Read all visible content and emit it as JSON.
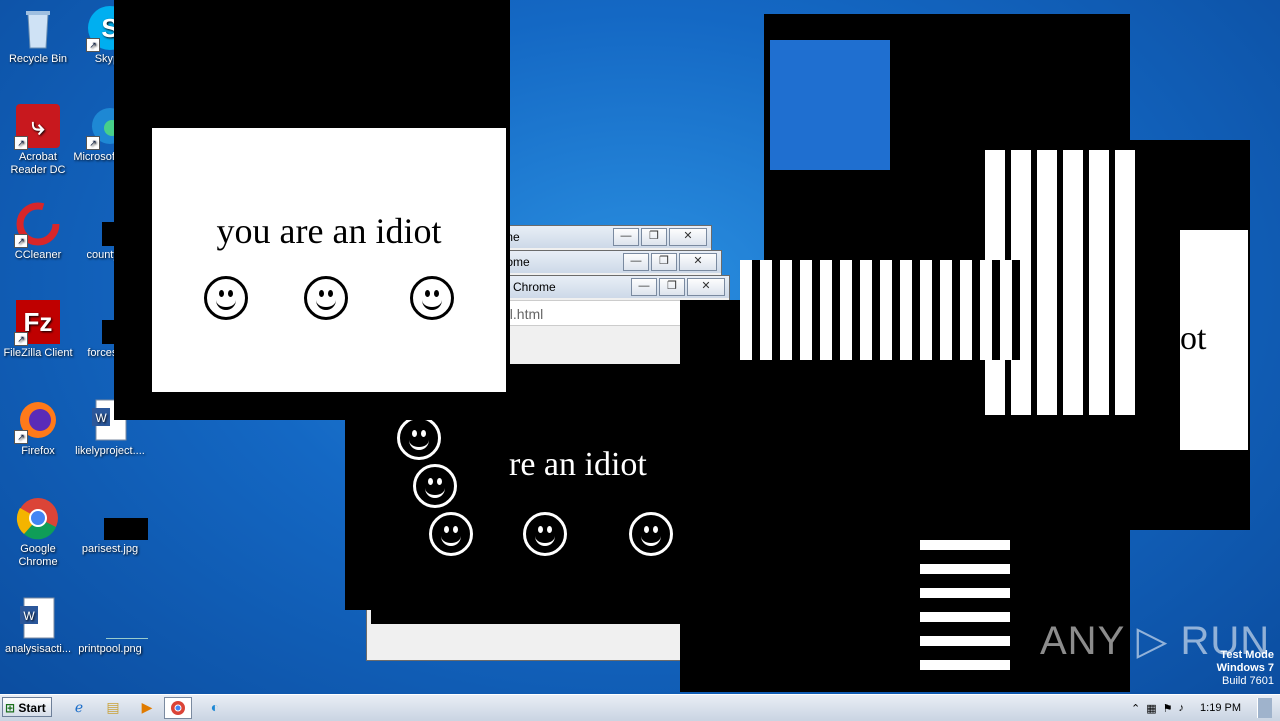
{
  "desktop": {
    "icons": [
      {
        "label": "Recycle Bin",
        "icon": "recycle-bin-icon"
      },
      {
        "label": "Skype",
        "icon": "skype-icon"
      },
      {
        "label": "Acrobat Reader DC",
        "icon": "acrobat-icon"
      },
      {
        "label": "Microsoft Edge",
        "icon": "edge-icon"
      },
      {
        "label": "CCleaner",
        "icon": "ccleaner-icon"
      },
      {
        "label": "countys...",
        "icon": "file-icon"
      },
      {
        "label": "FileZilla Client",
        "icon": "filezilla-icon"
      },
      {
        "label": "forcesh...",
        "icon": "file-icon"
      },
      {
        "label": "Firefox",
        "icon": "firefox-icon"
      },
      {
        "label": "likelyproject....",
        "icon": "word-doc-icon"
      },
      {
        "label": "Google Chrome",
        "icon": "chrome-icon"
      },
      {
        "label": "parisest.jpg",
        "icon": "image-icon"
      },
      {
        "label": "analysisacti...",
        "icon": "word-doc-icon"
      },
      {
        "label": "printpool.png",
        "icon": "image-icon"
      }
    ]
  },
  "popups": {
    "main_text": "you are an idiot",
    "partial_text": "re an idiot",
    "right_partial": "ot",
    "url_fragment": "ol.html",
    "chrome_titles": [
      "Chrome",
      "Chrome",
      "e Chrome"
    ]
  },
  "window_buttons": {
    "minimize": "—",
    "restore": "❐",
    "close": "✕"
  },
  "taskbar": {
    "start_label": "Start",
    "clock": "1:19 PM",
    "tray_arrow": "⌃"
  },
  "watermark": {
    "brand": "ANY ▷ RUN",
    "line1": "Test Mode",
    "line2": "Windows 7",
    "line3": "Build 7601"
  },
  "colors": {
    "desktop_blue": "#1468c4",
    "glitch_black": "#000000"
  }
}
